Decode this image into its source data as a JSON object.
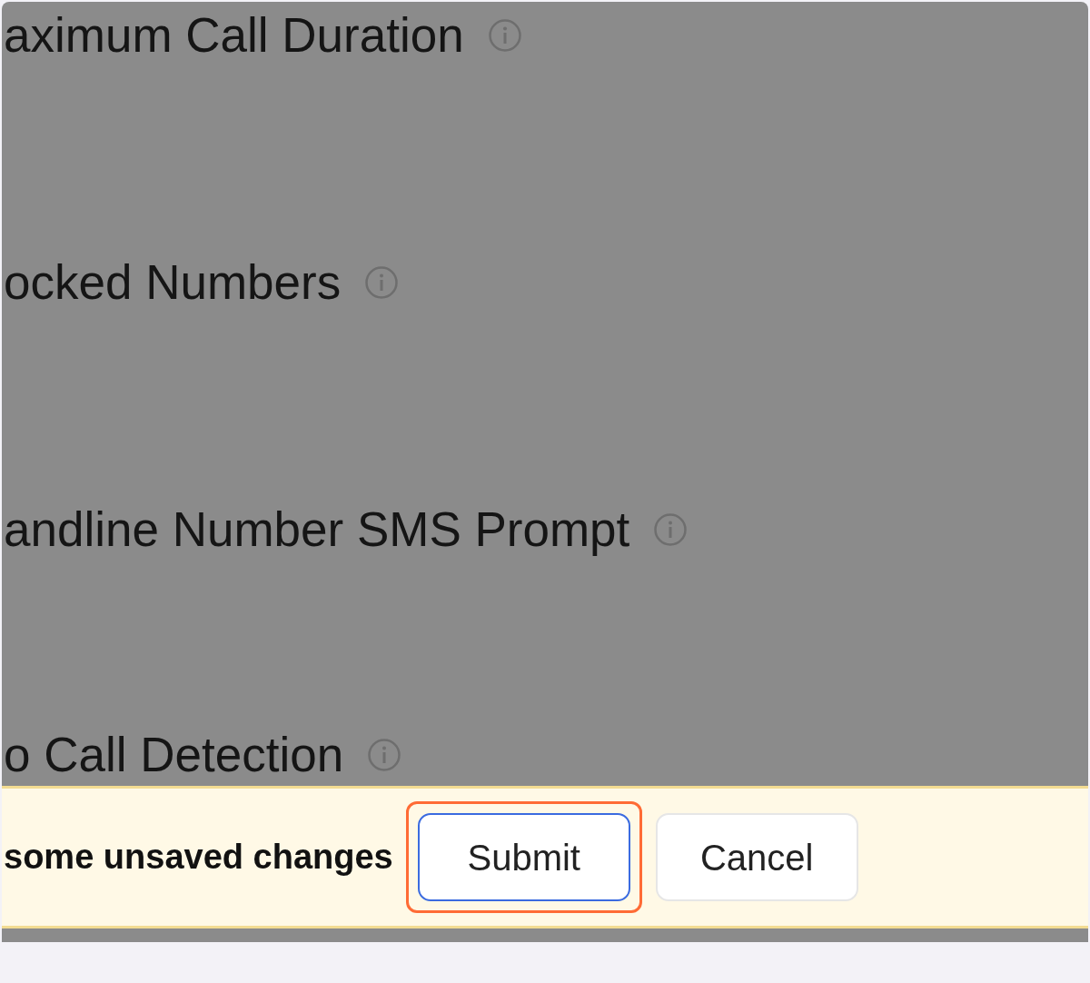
{
  "settings": [
    {
      "label": "aximum Call Duration"
    },
    {
      "label": "ocked Numbers"
    },
    {
      "label": "andline Number SMS Prompt"
    },
    {
      "label": "o Call Detection"
    }
  ],
  "unsaved_bar": {
    "message": "some unsaved changes",
    "buttons": [
      {
        "label": "Submit",
        "highlighted": true,
        "kind": "primary"
      },
      {
        "label": "Cancel",
        "highlighted": false,
        "kind": "secondary"
      }
    ]
  }
}
